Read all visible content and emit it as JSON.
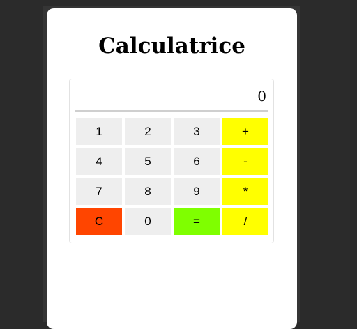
{
  "app": {
    "title": "Calculatrice"
  },
  "display": {
    "value": "0"
  },
  "keys": [
    {
      "label": "1",
      "name": "key-1",
      "color": "#eeeeee"
    },
    {
      "label": "2",
      "name": "key-2",
      "color": "#eeeeee"
    },
    {
      "label": "3",
      "name": "key-3",
      "color": "#eeeeee"
    },
    {
      "label": "+",
      "name": "key-plus",
      "color": "#ffff00"
    },
    {
      "label": "4",
      "name": "key-4",
      "color": "#eeeeee"
    },
    {
      "label": "5",
      "name": "key-5",
      "color": "#eeeeee"
    },
    {
      "label": "6",
      "name": "key-6",
      "color": "#eeeeee"
    },
    {
      "label": "-",
      "name": "key-minus",
      "color": "#ffff00"
    },
    {
      "label": "7",
      "name": "key-7",
      "color": "#eeeeee"
    },
    {
      "label": "8",
      "name": "key-8",
      "color": "#eeeeee"
    },
    {
      "label": "9",
      "name": "key-9",
      "color": "#eeeeee"
    },
    {
      "label": "*",
      "name": "key-multiply",
      "color": "#ffff00"
    },
    {
      "label": "C",
      "name": "key-clear",
      "color": "#ff4500"
    },
    {
      "label": "0",
      "name": "key-0",
      "color": "#eeeeee"
    },
    {
      "label": "=",
      "name": "key-equals",
      "color": "#7fff00"
    },
    {
      "label": "/",
      "name": "key-divide",
      "color": "#ffff00"
    }
  ]
}
